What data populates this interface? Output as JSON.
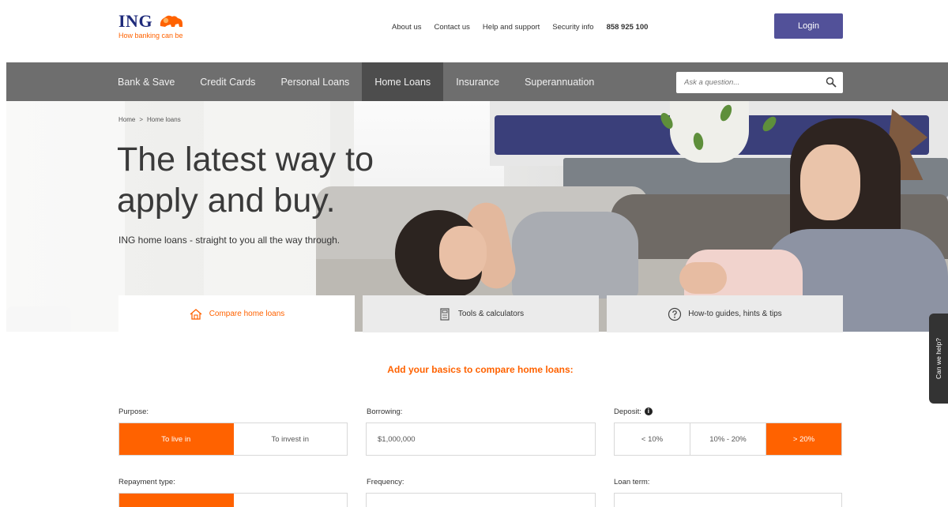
{
  "header": {
    "logo_text": "ING",
    "tagline": "How banking can be",
    "links": [
      "About us",
      "Contact us",
      "Help and support",
      "Security info"
    ],
    "phone": "858 925 100",
    "login_label": "Login"
  },
  "nav": {
    "items": [
      {
        "label": "Bank & Save"
      },
      {
        "label": "Credit Cards"
      },
      {
        "label": "Personal Loans"
      },
      {
        "label": "Home Loans",
        "active": true
      },
      {
        "label": "Insurance"
      },
      {
        "label": "Superannuation"
      }
    ],
    "search_placeholder": "Ask a question..."
  },
  "hero": {
    "breadcrumb": [
      "Home",
      ">",
      "Home loans"
    ],
    "title_line1": "The latest way to",
    "title_line2": "apply and buy.",
    "subtitle": "ING home loans - straight to you all the way through."
  },
  "tabs": [
    {
      "label": "Compare home loans",
      "icon": "house-icon",
      "active": true
    },
    {
      "label": "Tools & calculators",
      "icon": "calculator-icon"
    },
    {
      "label": "How-to guides, hints & tips",
      "icon": "question-icon"
    }
  ],
  "help_tab": "Can we help?",
  "form": {
    "heading": "Add your basics to compare home loans:",
    "purpose": {
      "label": "Purpose:",
      "options": [
        "To live in",
        "To invest in"
      ],
      "selected": 0
    },
    "borrowing": {
      "label": "Borrowing:",
      "value": "$1,000,000"
    },
    "deposit": {
      "label": "Deposit:",
      "options": [
        "< 10%",
        "10% - 20%",
        "> 20%"
      ],
      "selected": 2
    },
    "repayment": {
      "label": "Repayment type:"
    },
    "frequency": {
      "label": "Frequency:"
    },
    "loan_term": {
      "label": "Loan term:"
    }
  },
  "colors": {
    "brand_orange": "#ff6200",
    "brand_navy": "#1e2a7a",
    "login_purple": "#525199",
    "nav_gray": "#6e6e6e",
    "nav_active": "#4d4d4d"
  }
}
